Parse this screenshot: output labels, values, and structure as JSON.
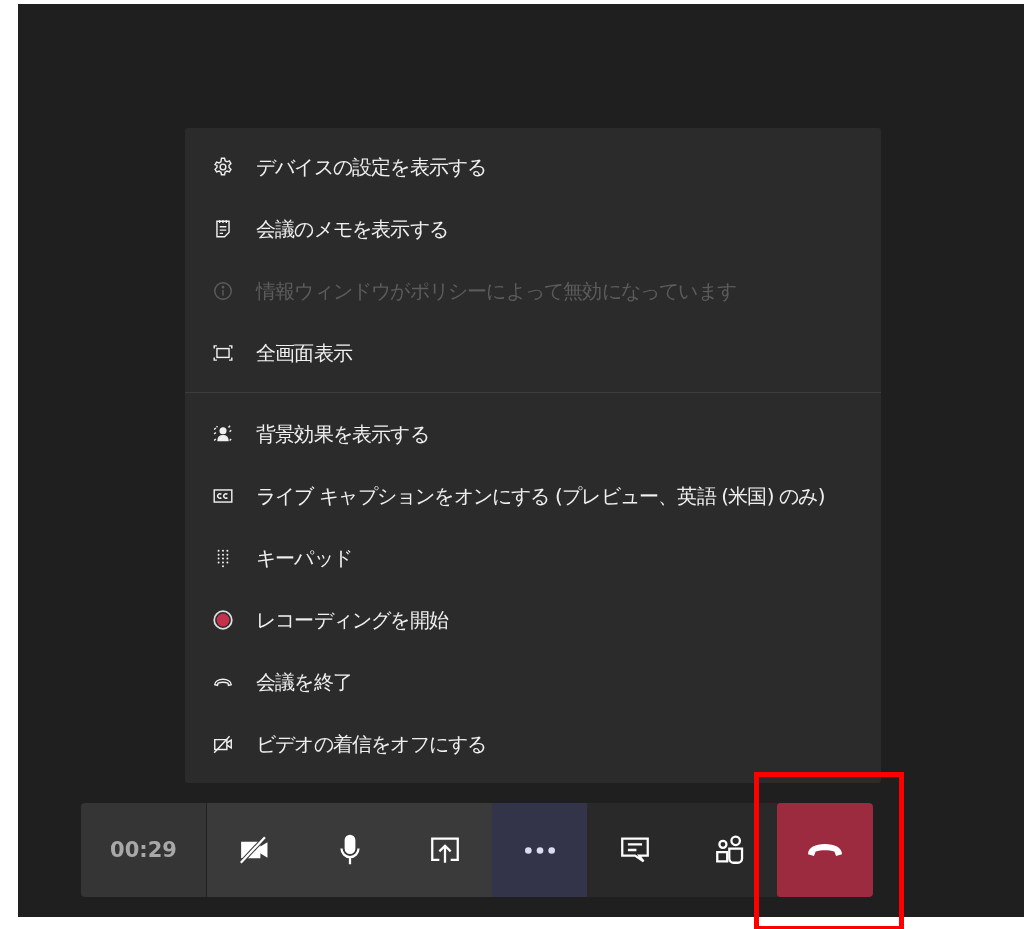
{
  "menu": {
    "sections": [
      [
        {
          "label": "デバイスの設定を表示する",
          "disabled": false
        },
        {
          "label": "会議のメモを表示する",
          "disabled": false
        },
        {
          "label": "情報ウィンドウがポリシーによって無効になっています",
          "disabled": true
        },
        {
          "label": "全画面表示",
          "disabled": false
        }
      ],
      [
        {
          "label": "背景効果を表示する",
          "disabled": false
        },
        {
          "label": "ライブ キャプションをオンにする (プレビュー、英語 (米国) のみ)",
          "disabled": false
        },
        {
          "label": "キーパッド",
          "disabled": false
        },
        {
          "label": "レコーディングを開始",
          "disabled": false
        },
        {
          "label": "会議を終了",
          "disabled": false
        },
        {
          "label": "ビデオの着信をオフにする",
          "disabled": false
        }
      ]
    ]
  },
  "toolbar": {
    "timer": "00:29",
    "buttons": [
      {
        "selected": false
      },
      {
        "selected": false
      },
      {
        "selected": false
      },
      {
        "selected": true
      },
      {
        "selected": false
      },
      {
        "selected": false
      },
      {
        "selected": false
      }
    ]
  }
}
